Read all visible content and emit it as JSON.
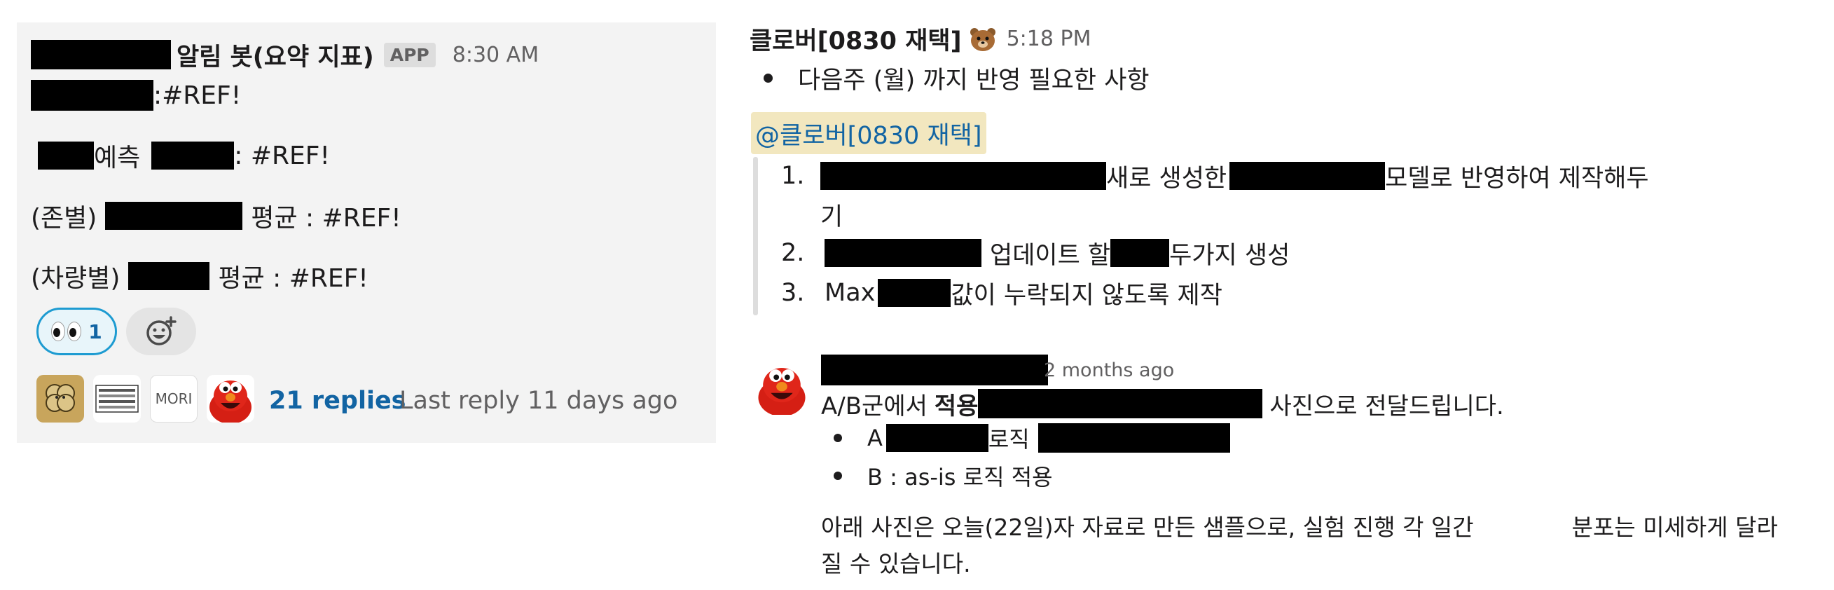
{
  "left_message": {
    "bot_name": "알림 봇(요약 지표)",
    "app_badge": "APP",
    "time": "8:30 AM",
    "lines": [
      ":#REF!",
      "예측",
      ": #REF!",
      "(존별)",
      "평균 : #REF!",
      "(차량별)",
      "평균 : #REF!"
    ],
    "reaction": {
      "emoji": "eyes",
      "count": "1"
    },
    "avatar3_label": "MORI",
    "replies": "21 replies",
    "last_reply": "Last reply 11 days ago"
  },
  "right_message": {
    "sender": "클로버[0830 재택]",
    "sender_emoji": "bear-icon",
    "time": "5:18 PM",
    "bullet": "다음주 (월) 까지 반영 필요한 사항",
    "mention": "@클로버[0830 재택]",
    "list": [
      {
        "num": "1.",
        "a": "새로 생성한",
        "b": "모델로 반영하여 제작해두",
        "cont": "기"
      },
      {
        "num": "2.",
        "a": "업데이트 할",
        "b": "두가지 생성"
      },
      {
        "num": "3.",
        "a": "Max",
        "b": "값이 누락되지 않도록 제작"
      }
    ]
  },
  "reply_message": {
    "time": "2 months ago",
    "line1_a": "A/B군에서",
    "line1_bold": "적용",
    "line1_b": "사진으로 전달드립니다.",
    "bullets": [
      {
        "a": "A :",
        "b": "로직"
      },
      {
        "a": "B : as-is 로직 적용"
      }
    ],
    "para_a": "아래 사진은 오늘(22일)자 자료로 만든 샘플으로, 실험 진행 각 일간",
    "para_b": "분포는 미세하게 달라",
    "para_c": "질 수 있습니다."
  }
}
